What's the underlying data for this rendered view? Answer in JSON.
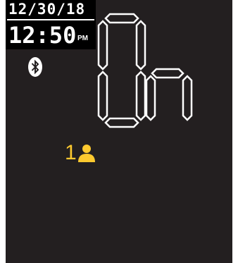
{
  "status": {
    "date": "12/30/18",
    "time": "12:50",
    "ampm": "PM",
    "bluetooth_icon": "bluetooth-icon"
  },
  "main_display": {
    "text": "On"
  },
  "user": {
    "number": "1",
    "icon": "user-icon"
  },
  "colors": {
    "background": "#231f20",
    "panel": "#000000",
    "foreground": "#ffffff",
    "accent": "#fdc92f"
  }
}
